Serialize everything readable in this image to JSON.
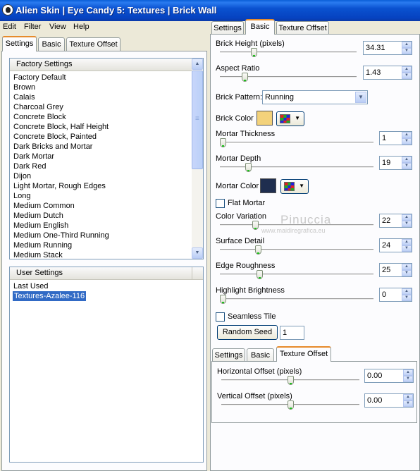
{
  "window": {
    "title": "Alien Skin  |  Eye Candy 5: Textures  |  Brick Wall"
  },
  "menu": {
    "items": [
      "Edit",
      "Filter",
      "View",
      "Help"
    ]
  },
  "left_tabs": [
    "Settings",
    "Basic",
    "Texture Offset"
  ],
  "factory_settings": {
    "header": "Factory Settings",
    "items": [
      "Factory Default",
      "Brown",
      "Calais",
      "Charcoal Grey",
      "Concrete Block",
      "Concrete Block, Half Height",
      "Concrete Block, Painted",
      "Dark Bricks and Mortar",
      "Dark Mortar",
      "Dark Red",
      "Dijon",
      "Light Mortar, Rough Edges",
      "Long",
      "Medium Common",
      "Medium Dutch",
      "Medium English",
      "Medium One-Third Running",
      "Medium Running",
      "Medium Stack"
    ]
  },
  "user_settings": {
    "header": "User Settings",
    "items": [
      "Last Used",
      "Textures-Azalee-116"
    ],
    "selected_index": 1
  },
  "right_tabs": [
    "Settings",
    "Basic",
    "Texture Offset"
  ],
  "basic": {
    "brick_height": {
      "label": "Brick Height (pixels)",
      "value": "34.31",
      "level": 0.24
    },
    "aspect_ratio": {
      "label": "Aspect Ratio",
      "value": "1.43",
      "level": 0.17
    },
    "brick_pattern": {
      "label": "Brick Pattern:",
      "value": "Running"
    },
    "brick_color": {
      "label": "Brick Color",
      "color": "#f3d27b"
    },
    "mortar_thickness": {
      "label": "Mortar Thickness",
      "value": "1",
      "level": 0.0
    },
    "mortar_depth": {
      "label": "Mortar Depth",
      "value": "19",
      "level": 0.17
    },
    "mortar_color": {
      "label": "Mortar Color",
      "color": "#1f2e4f"
    },
    "flat_mortar": {
      "label": "Flat Mortar",
      "checked": false
    },
    "color_variation": {
      "label": "Color Variation",
      "value": "22",
      "level": 0.22
    },
    "surface_detail": {
      "label": "Surface Detail",
      "value": "24",
      "level": 0.24
    },
    "edge_roughness": {
      "label": "Edge Roughness",
      "value": "25",
      "level": 0.25
    },
    "highlight_brightness": {
      "label": "Highlight Brightness",
      "value": "0",
      "level": 0.0
    },
    "seamless_tile": {
      "label": "Seamless Tile",
      "checked": false
    },
    "random_seed": {
      "button": "Random Seed",
      "value": "1"
    }
  },
  "texture_offset_tabs": [
    "Settings",
    "Basic",
    "Texture Offset"
  ],
  "texture_offset": {
    "horizontal": {
      "label": "Horizontal Offset (pixels)",
      "value": "0.00",
      "level": 0.5
    },
    "vertical": {
      "label": "Vertical Offset (pixels)",
      "value": "0.00",
      "level": 0.5
    }
  },
  "watermark": {
    "name": "Pinuccia",
    "url": "www.maidiregrafica.eu"
  },
  "icons": {
    "app": "alien-skin-icon",
    "palette": "palette-icon",
    "scroll_up": "arrow-up-icon",
    "scroll_down": "arrow-down-icon"
  }
}
